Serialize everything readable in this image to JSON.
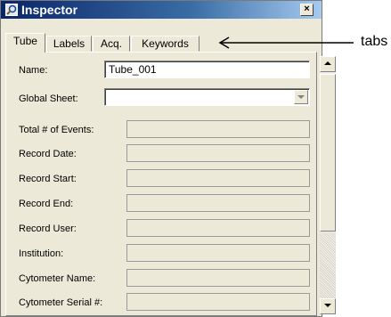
{
  "window": {
    "title": "Inspector",
    "close_label": "×"
  },
  "tabs": [
    {
      "label": "Tube",
      "selected": true
    },
    {
      "label": "Labels",
      "selected": false
    },
    {
      "label": "Acq.",
      "selected": false
    },
    {
      "label": "Keywords",
      "selected": false
    }
  ],
  "fields": {
    "name": {
      "label": "Name:",
      "value": "Tube_001"
    },
    "global_sheet": {
      "label": "Global Sheet:",
      "value": ""
    },
    "total_events": {
      "label": "Total # of Events:",
      "value": ""
    },
    "record_date": {
      "label": "Record Date:",
      "value": ""
    },
    "record_start": {
      "label": "Record Start:",
      "value": ""
    },
    "record_end": {
      "label": "Record End:",
      "value": ""
    },
    "record_user": {
      "label": "Record User:",
      "value": ""
    },
    "institution": {
      "label": "Institution:",
      "value": ""
    },
    "cytometer_name": {
      "label": "Cytometer Name:",
      "value": ""
    },
    "cytometer_serial": {
      "label": "Cytometer Serial #:",
      "value": ""
    }
  },
  "annotation": {
    "label": "tabs"
  },
  "icons": {
    "title": "magnifier-icon",
    "combo": "dropdown-arrow-icon",
    "scroll_up": "scroll-up-arrow-icon",
    "scroll_down": "scroll-down-arrow-icon",
    "annotation": "arrow-left-icon"
  }
}
